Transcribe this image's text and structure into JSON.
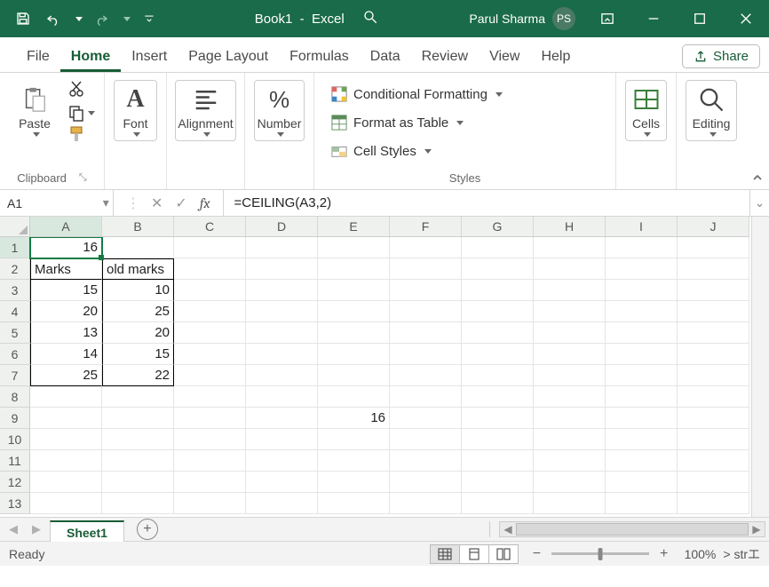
{
  "title": {
    "doc": "Book1",
    "app": "Excel"
  },
  "user": {
    "name": "Parul Sharma",
    "initials": "PS"
  },
  "tabs": {
    "file": "File",
    "home": "Home",
    "insert": "Insert",
    "pagelayout": "Page Layout",
    "formulas": "Formulas",
    "data": "Data",
    "review": "Review",
    "view": "View",
    "help": "Help"
  },
  "share_label": "Share",
  "ribbon": {
    "clipboard": {
      "paste": "Paste",
      "label": "Clipboard"
    },
    "font": {
      "label": "Font"
    },
    "alignment": {
      "label": "Alignment"
    },
    "number": {
      "label": "Number"
    },
    "styles": {
      "cond": "Conditional Formatting",
      "table": "Format as Table",
      "cell": "Cell Styles",
      "label": "Styles"
    },
    "cells": {
      "label": "Cells"
    },
    "editing": {
      "label": "Editing"
    }
  },
  "name_box": "A1",
  "formula": "=CEILING(A3,2)",
  "columns": [
    "A",
    "B",
    "C",
    "D",
    "E",
    "F",
    "G",
    "H",
    "I",
    "J"
  ],
  "row_numbers": [
    1,
    2,
    3,
    4,
    5,
    6,
    7,
    8,
    9,
    10,
    11,
    12,
    13
  ],
  "cells": {
    "A1": "16",
    "A2": "Marks",
    "B2": "old marks",
    "A3": "15",
    "B3": "10",
    "A4": "20",
    "B4": "25",
    "A5": "13",
    "B5": "20",
    "A6": "14",
    "B6": "15",
    "A7": "25",
    "B7": "22",
    "E9": "16"
  },
  "sheet_name": "Sheet1",
  "status_text": "Ready",
  "zoom": "100%"
}
